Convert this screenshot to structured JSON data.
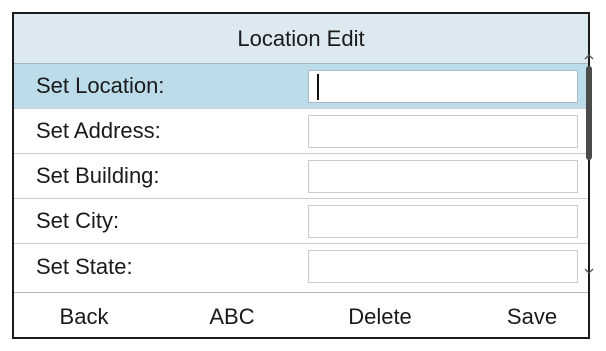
{
  "screen": {
    "title": "Location Edit"
  },
  "fields": [
    {
      "label": "Set Location:",
      "value": "",
      "selected": true
    },
    {
      "label": "Set Address:",
      "value": "",
      "selected": false
    },
    {
      "label": "Set Building:",
      "value": "",
      "selected": false
    },
    {
      "label": "Set City:",
      "value": "",
      "selected": false
    },
    {
      "label": "Set State:",
      "value": "",
      "selected": false
    }
  ],
  "scrollbar": {
    "up_icon": "chevron-up-icon",
    "down_icon": "chevron-down-icon"
  },
  "softkeys": {
    "back": "Back",
    "abc": "ABC",
    "delete": "Delete",
    "save": "Save"
  },
  "colors": {
    "title_bg": "#dde9f1",
    "selected_row_bg": "#bcdcea",
    "border": "#1a1a1a"
  }
}
